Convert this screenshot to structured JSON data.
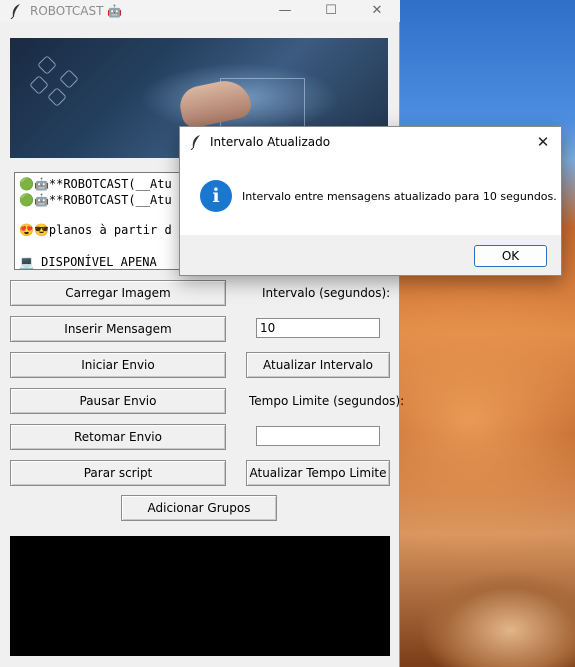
{
  "app": {
    "title": "ROBOTCAST 🤖",
    "controls": {
      "minimize": "—",
      "maximize": "☐",
      "close": "✕"
    }
  },
  "banner": {
    "description_icon": "laptop-tech-banner-image"
  },
  "textbox": {
    "lines": [
      "🟢🤖**ROBOTCAST(__Atu",
      "🟢🤖**ROBOTCAST(__Atu",
      "😍😎planos à partir d",
      "💻  DISPONÍVEL APENA"
    ]
  },
  "buttons": {
    "carregar_imagem": "Carregar Imagem",
    "inserir_mensagem": "Inserir Mensagem",
    "iniciar_envio": "Iniciar Envio",
    "pausar_envio": "Pausar Envio",
    "retomar_envio": "Retomar Envio",
    "parar_script": "Parar script",
    "atualizar_intervalo": "Atualizar Intervalo",
    "atualizar_tempo_limite": "Atualizar Tempo Limite",
    "adicionar_grupos": "Adicionar Grupos"
  },
  "labels": {
    "intervalo": "Intervalo (segundos):",
    "tempo_limite": "Tempo Limite (segundos):"
  },
  "inputs": {
    "intervalo_value": "10",
    "tempo_limite_value": ""
  },
  "dialog": {
    "title": "Intervalo Atualizado",
    "close": "✕",
    "icon": "info-icon",
    "message": "Intervalo entre mensagens atualizado para 10 segundos.",
    "ok": "OK"
  },
  "colors": {
    "info_icon": "#1a77cf",
    "ok_border": "#2b6fc4",
    "console_bg": "#000000"
  }
}
